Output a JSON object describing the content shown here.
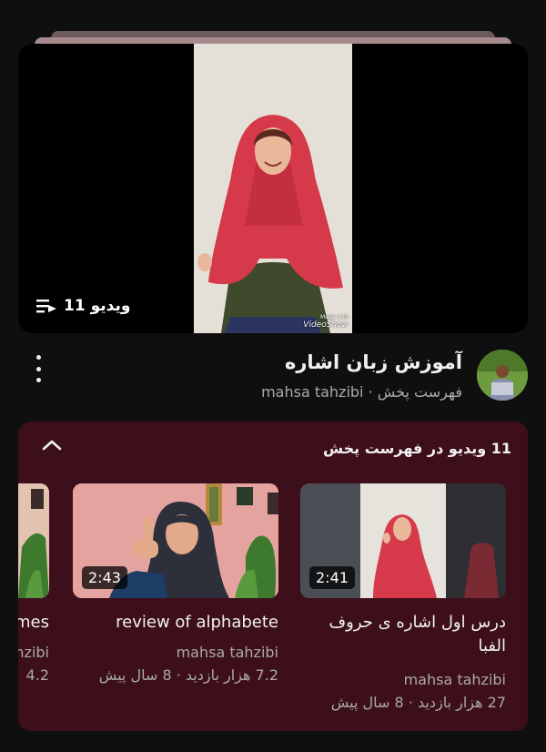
{
  "hero": {
    "video_count_label": "11 ویدیو",
    "watermark_top": "Made with",
    "watermark_brand": "VideoShow",
    "list_icon": "playlist-icon"
  },
  "playlist": {
    "title": "آموزش زبان اشاره",
    "subtitle": "فهرست پخش · mahsa tahzibi",
    "more_icon": "more-vert-icon"
  },
  "panel": {
    "header": "11 ویدیو در فهرست پخش",
    "collapse_icon": "chevron-up-icon",
    "background": "#3d0f1a",
    "cards": [
      {
        "title": "درس اول اشاره ی حروف الفبا",
        "duration": "2:41",
        "channel": "mahsa tahzibi",
        "meta": "27 هزار بازدید · 8 سال پیش"
      },
      {
        "title": "review of alphabete",
        "duration": "2:43",
        "channel": "mahsa tahzibi",
        "meta": "7.2 هزار بازدید · 8 سال پیش"
      },
      {
        "title": "mes",
        "channel": "nzibi",
        "meta": "4.2"
      }
    ]
  }
}
